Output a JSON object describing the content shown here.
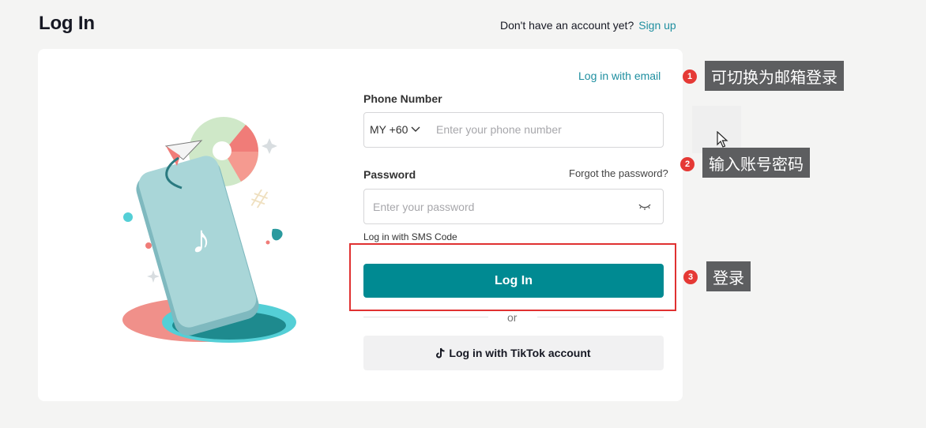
{
  "header": {
    "title": "Log In",
    "signup_prompt": "Don't have an account yet?",
    "signup_link": "Sign up"
  },
  "form": {
    "email_link": "Log in with email",
    "phone_label": "Phone Number",
    "country_code": "MY +60",
    "phone_placeholder": "Enter your phone number",
    "password_label": "Password",
    "forgot_link": "Forgot the password?",
    "password_placeholder": "Enter your password",
    "sms_link": "Log in with SMS Code",
    "login_button": "Log In",
    "or_text": "or",
    "tiktok_button": "Log in with TikTok account"
  },
  "annotations": [
    {
      "num": "1",
      "text": "可切换为邮箱登录"
    },
    {
      "num": "2",
      "text": "输入账号密码"
    },
    {
      "num": "3",
      "text": "登录"
    }
  ],
  "colors": {
    "accent": "#008a92",
    "link": "#1f8fa0",
    "highlight": "#e03131",
    "tip_bg": "#5d5e60"
  },
  "icons": [
    "chevron-down-icon",
    "eye-closed-icon",
    "tiktok-logo-icon",
    "mouse-cursor-icon"
  ]
}
